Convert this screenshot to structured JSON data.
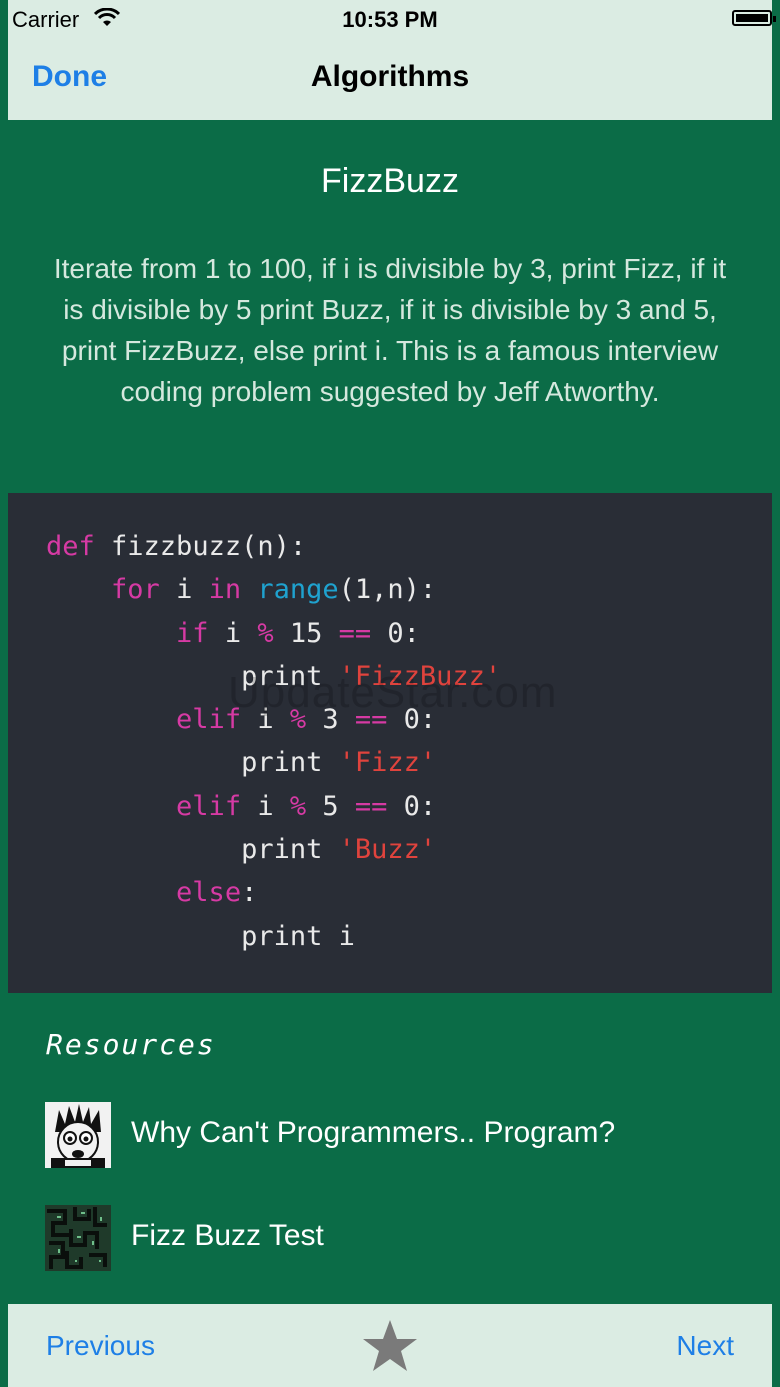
{
  "status_bar": {
    "carrier": "Carrier",
    "time": "10:53 PM"
  },
  "nav": {
    "back_label": "Done",
    "title": "Algorithms"
  },
  "problem": {
    "title": "FizzBuzz",
    "description": "Iterate from 1 to 100, if i is divisible by 3, print Fizz, if it is divisible by 5 print Buzz, if it is divisible by 3 and 5, print FizzBuzz, else print i. This is a famous interview coding problem suggested by Jeff Atworthy."
  },
  "code": {
    "line1_kw": "def",
    "line1_rest": " fizzbuzz(n):",
    "line2_kw_for": "for",
    "line2_i": " i ",
    "line2_kw_in": "in",
    "line2_bi": "range",
    "line2_rest": "(1,n):",
    "line3_kw_if": "if",
    "line3_i": " i ",
    "line3_op_mod": "%",
    "line3_num": " 15 ",
    "line3_op_eq": "==",
    "line3_rest": " 0:",
    "line4_print": "print",
    "line4_str": "'FizzBuzz'",
    "line5_kw": "elif",
    "line5_i": " i ",
    "line5_op_mod": "%",
    "line5_num": " 3 ",
    "line5_op_eq": "==",
    "line5_rest": " 0:",
    "line6_print": "print",
    "line6_str": "'Fizz'",
    "line7_kw": "elif",
    "line7_i": " i ",
    "line7_op_mod": "%",
    "line7_num": " 5 ",
    "line7_op_eq": "==",
    "line7_rest": " 0:",
    "line8_print": "print",
    "line8_str": "'Buzz'",
    "line9_kw": "else",
    "line9_rest": ":",
    "line10_print": "print i"
  },
  "watermark": "UpdateStar.com",
  "resources": {
    "label": "Resources",
    "items": [
      {
        "label": "Why Can't Programmers.. Program?",
        "icon": "cartoon-face-icon"
      },
      {
        "label": "Fizz Buzz Test",
        "icon": "pattern-tile-icon"
      }
    ]
  },
  "toolbar": {
    "previous_label": "Previous",
    "next_label": "Next",
    "star_icon": "star-icon"
  },
  "colors": {
    "background": "#0b6c47",
    "bar": "#dbece3",
    "accent": "#1e7fe6",
    "code_bg": "#292d36",
    "keyword": "#d63aa4",
    "builtin": "#1fa2cf",
    "string": "#e0433d"
  }
}
